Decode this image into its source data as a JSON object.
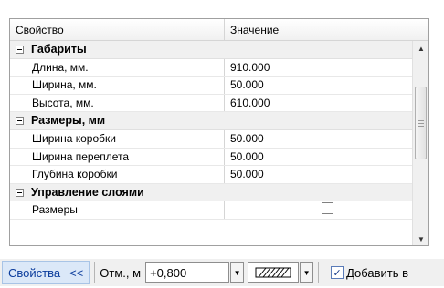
{
  "grid": {
    "header": {
      "property": "Свойство",
      "value": "Значение"
    },
    "rows": [
      {
        "type": "category",
        "label": "Габариты"
      },
      {
        "type": "prop",
        "name": "Длина, мм.",
        "value": "910.000"
      },
      {
        "type": "prop",
        "name": "Ширина, мм.",
        "value": "50.000"
      },
      {
        "type": "prop",
        "name": "Высота, мм.",
        "value": "610.000"
      },
      {
        "type": "category",
        "label": "Размеры, мм"
      },
      {
        "type": "prop",
        "name": "Ширина коробки",
        "value": "50.000"
      },
      {
        "type": "prop",
        "name": "Ширина переплета",
        "value": "50.000"
      },
      {
        "type": "prop",
        "name": "Глубина коробки",
        "value": "50.000"
      },
      {
        "type": "category",
        "label": "Управление слоями"
      },
      {
        "type": "prop",
        "name": "Размеры",
        "value": ""
      }
    ]
  },
  "toolbar": {
    "properties_label": "Свойства",
    "properties_chevron": "<<",
    "otm_label": "Отм., м",
    "otm_value": "+0,800",
    "add_label": "Добавить в"
  },
  "icons": {
    "collapse": "minus-box-icon",
    "hatch": "hatch-pattern-icon",
    "dropdown": "chevron-down-icon",
    "checkbox": "checkmark-icon"
  }
}
